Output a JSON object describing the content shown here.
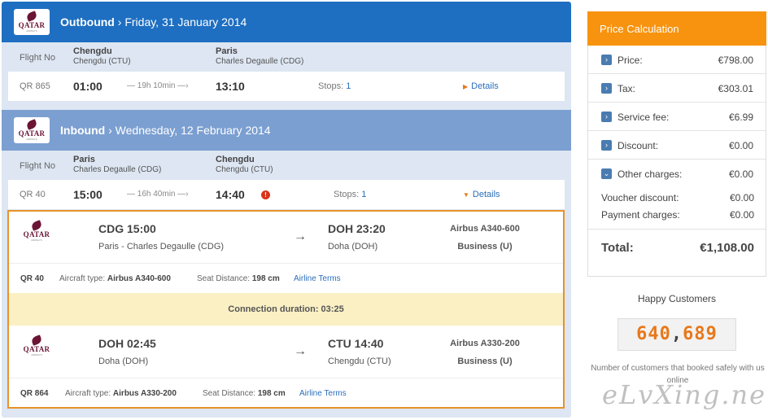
{
  "airline": {
    "logo_text": "QATAR",
    "logo_sub": "AIRWAYS"
  },
  "outbound": {
    "label": "Outbound",
    "date": "Friday, 31 January 2014",
    "header": {
      "flight_no_label": "Flight No",
      "from_city": "Chengdu",
      "from_airport": "Chengdu (CTU)",
      "to_city": "Paris",
      "to_airport": "Charles Degaulle (CDG)"
    },
    "flight": {
      "number": "QR 865",
      "depart": "01:00",
      "duration": "— 19h 10min —›",
      "arrive": "13:10",
      "stops_label": "Stops:",
      "stops": "1",
      "details": "Details"
    }
  },
  "inbound": {
    "label": "Inbound",
    "date": "Wednesday, 12 February 2014",
    "header": {
      "flight_no_label": "Flight No",
      "from_city": "Paris",
      "from_airport": "Charles Degaulle (CDG)",
      "to_city": "Chengdu",
      "to_airport": "Chengdu (CTU)"
    },
    "flight": {
      "number": "QR 40",
      "depart": "15:00",
      "duration": "— 16h 40min —›",
      "arrive": "14:40",
      "stops_label": "Stops:",
      "stops": "1",
      "details": "Details",
      "warning": "!"
    },
    "segments": [
      {
        "from_code": "CDG 15:00",
        "from_place": "Paris - Charles Degaulle (CDG)",
        "to_code": "DOH 23:20",
        "to_place": "Doha (DOH)",
        "aircraft": "Airbus A340-600",
        "cabin": "Business (U)",
        "info": {
          "number": "QR 40",
          "aircraft_label": "Aircraft type:",
          "aircraft": "Airbus A340-600",
          "seat_label": "Seat Distance:",
          "seat": "198 cm",
          "terms": "Airline Terms"
        }
      },
      {
        "from_code": "DOH 02:45",
        "from_place": "Doha (DOH)",
        "to_code": "CTU 14:40",
        "to_place": "Chengdu (CTU)",
        "aircraft": "Airbus A330-200",
        "cabin": "Business (U)",
        "info": {
          "number": "QR 864",
          "aircraft_label": "Aircraft type:",
          "aircraft": "Airbus A330-200",
          "seat_label": "Seat Distance:",
          "seat": "198 cm",
          "terms": "Airline Terms"
        }
      }
    ],
    "connection": "Connection duration: 03:25"
  },
  "price": {
    "title": "Price Calculation",
    "rows": [
      {
        "label": "Price:",
        "value": "€798.00",
        "icon": "chevron-right-icon"
      },
      {
        "label": "Tax:",
        "value": "€303.01",
        "icon": "chevron-right-icon"
      },
      {
        "label": "Service fee:",
        "value": "€6.99",
        "icon": "chevron-right-icon"
      },
      {
        "label": "Discount:",
        "value": "€0.00",
        "icon": "chevron-right-icon"
      },
      {
        "label": "Other charges:",
        "value": "€0.00",
        "icon": "chevron-down-icon"
      }
    ],
    "voucher_label": "Voucher discount:",
    "voucher_value": "€0.00",
    "payment_label": "Payment charges:",
    "payment_value": "€0.00",
    "total_label": "Total:",
    "total_value": "€1,108.00"
  },
  "happy": {
    "title": "Happy Customers",
    "count_a": "640",
    "count_b": "689",
    "note": "Number of customers that booked safely with us online"
  },
  "watermark": "eLvXing.net",
  "colors": {
    "outbound_bar": "#1e6fc1",
    "inbound_bar": "#7b9fd1",
    "accent": "#f7930f",
    "highlight_border": "#e8922a",
    "link": "#2a6ebb"
  }
}
